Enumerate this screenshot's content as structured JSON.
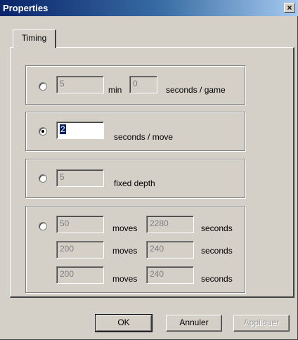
{
  "window": {
    "title": "Properties",
    "close_label": "×"
  },
  "tabs": [
    {
      "label": "Timing",
      "selected": true
    }
  ],
  "groups": {
    "game": {
      "selected": false,
      "min_value": "5",
      "min_label": "min",
      "sec_value": "0",
      "sec_label": "seconds / game"
    },
    "move": {
      "selected": true,
      "value": "2",
      "label": "seconds / move"
    },
    "depth": {
      "selected": false,
      "value": "5",
      "label": "fixed depth"
    },
    "tournament": {
      "selected": false,
      "rows": [
        {
          "moves_value": "50",
          "moves_label": "moves",
          "seconds_value": "2280",
          "seconds_label": "seconds"
        },
        {
          "moves_value": "200",
          "moves_label": "moves",
          "seconds_value": "240",
          "seconds_label": "seconds"
        },
        {
          "moves_value": "200",
          "moves_label": "moves",
          "seconds_value": "240",
          "seconds_label": "seconds"
        }
      ]
    }
  },
  "buttons": {
    "ok": "OK",
    "cancel": "Annuler",
    "apply": "Appliquer"
  }
}
